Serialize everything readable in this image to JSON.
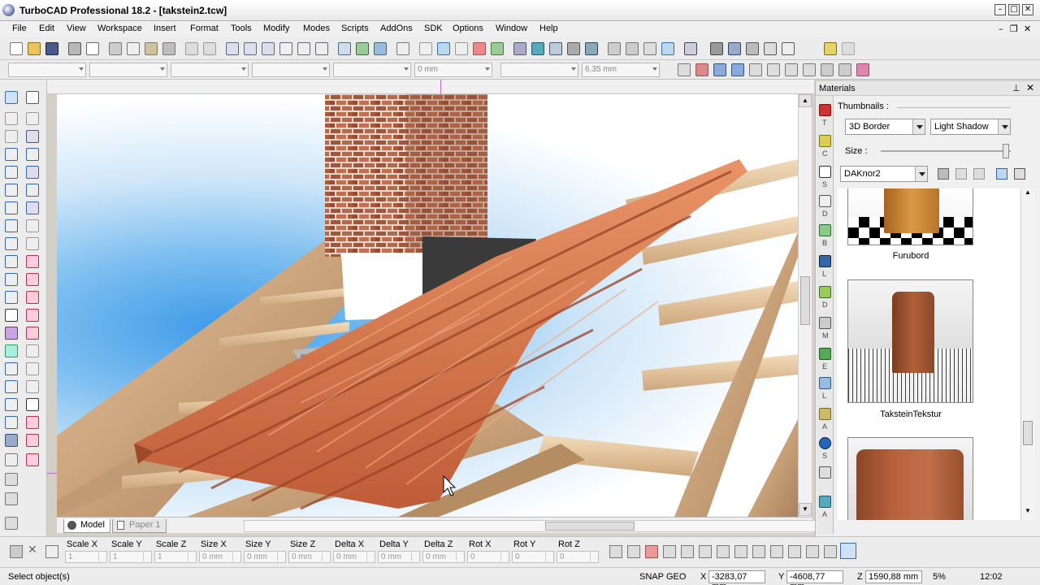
{
  "window": {
    "title": "TurboCAD Professional 18.2 - [takstein2.tcw]",
    "controls": [
      "–",
      "□",
      "✕"
    ],
    "mdi_controls": [
      "–",
      "❐",
      "✕"
    ]
  },
  "menu": [
    "File",
    "Edit",
    "View",
    "Workspace",
    "Insert",
    "Format",
    "Tools",
    "Modify",
    "Modes",
    "Scripts",
    "AddOns",
    "SDK",
    "Options",
    "Window",
    "Help"
  ],
  "property_bar": {
    "combo_5": "0 mm",
    "combo_7": "6,35 mm"
  },
  "tabs": {
    "model": "Model",
    "paper": "Paper 1"
  },
  "materials": {
    "title": "Materials",
    "thumbnails_label": "Thumbnails :",
    "border_select": "3D Border",
    "shadow_select": "Light Shadow",
    "size_label": "Size :",
    "library_select": "DAKnor2",
    "items": [
      "Furubord",
      "TaksteinTekstur"
    ]
  },
  "side_strip_letters": [
    "T",
    "C",
    "S",
    "D",
    "B",
    "L",
    "D",
    "M",
    "E",
    "L",
    "A",
    "S",
    "A"
  ],
  "command_fields": [
    {
      "label": "Scale X",
      "value": "1"
    },
    {
      "label": "Scale Y",
      "value": "1"
    },
    {
      "label": "Scale Z",
      "value": "1"
    },
    {
      "label": "Size X",
      "value": "0 mm"
    },
    {
      "label": "Size Y",
      "value": "0 mm"
    },
    {
      "label": "Size Z",
      "value": "0 mm"
    },
    {
      "label": "Delta X",
      "value": "0 mm"
    },
    {
      "label": "Delta Y",
      "value": "0 mm"
    },
    {
      "label": "Delta Z",
      "value": "0 mm"
    },
    {
      "label": "Rot X",
      "value": "0"
    },
    {
      "label": "Rot Y",
      "value": "0"
    },
    {
      "label": "Rot Z",
      "value": "0"
    }
  ],
  "status": {
    "prompt": "Select object(s)",
    "snap": "SNAP",
    "geo": "GEO",
    "x_label": "X",
    "x": "-3283,07 mm",
    "y_label": "Y",
    "y": "-4608,77 mm",
    "z_label": "Z",
    "z": "1590,88 mm",
    "zoom": "5%",
    "time": "12:02"
  },
  "colors": {
    "sky": "#7bbdf0",
    "tile": "#d5744c",
    "brick": "#a85a3c",
    "wood": "#d9b48a"
  }
}
